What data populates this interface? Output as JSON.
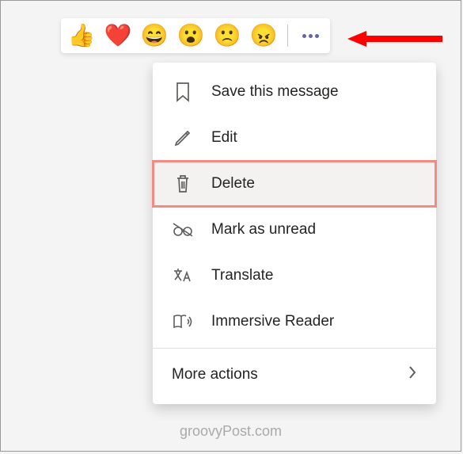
{
  "reactions": [
    {
      "name": "thumbs-up",
      "glyph": "👍"
    },
    {
      "name": "heart",
      "glyph": "❤️"
    },
    {
      "name": "laugh",
      "glyph": "😄"
    },
    {
      "name": "surprised",
      "glyph": "😮"
    },
    {
      "name": "sad",
      "glyph": "🙁"
    },
    {
      "name": "angry",
      "glyph": "😠"
    }
  ],
  "menu": {
    "save": "Save this message",
    "edit": "Edit",
    "delete": "Delete",
    "mark_unread": "Mark as unread",
    "translate": "Translate",
    "immersive": "Immersive Reader",
    "more": "More actions"
  },
  "annotation": {
    "highlight_color": "#f28b82",
    "arrow_color": "#ff0000"
  },
  "watermark": "groovyPost.com"
}
